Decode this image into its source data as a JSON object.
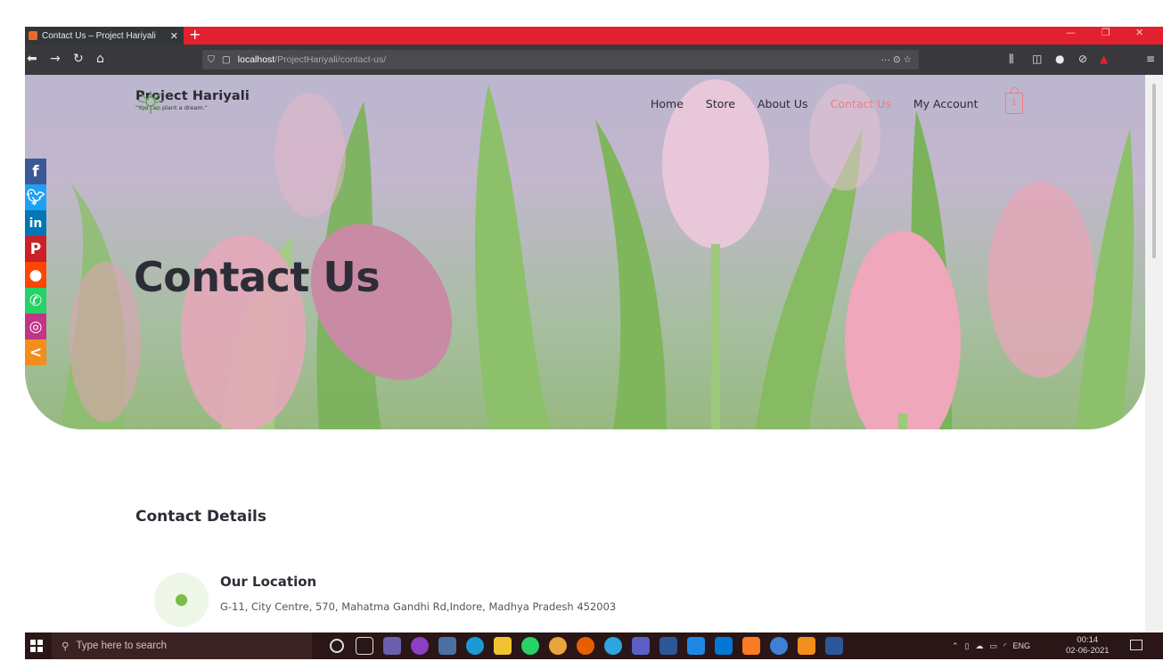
{
  "browser": {
    "tab_title": "Contact Us – Project Hariyali",
    "tab_close": "✕",
    "new_tab": "+",
    "url_host": "localhost",
    "url_path": "/ProjectHariyali/contact-us/",
    "url_actions": "··· ⊙ ☆"
  },
  "site": {
    "brand_name": "Project Hariyali",
    "tagline": "\"You can plant a dream.\"",
    "nav": [
      {
        "label": "Home"
      },
      {
        "label": "Store"
      },
      {
        "label": "About Us"
      },
      {
        "label": "Contact Us"
      },
      {
        "label": "My Account"
      }
    ],
    "active_nav": "Contact Us",
    "cart_count": "1",
    "accent_color": "#f07c7c",
    "hero_title": "Contact Us"
  },
  "social": [
    {
      "icon": "facebook-icon",
      "glyph": "f",
      "color": "#3b5998"
    },
    {
      "icon": "twitter-icon",
      "glyph": "🐦︎",
      "color": "#1da1f2"
    },
    {
      "icon": "linkedin-icon",
      "glyph": "in",
      "color": "#0077b5"
    },
    {
      "icon": "pinterest-icon",
      "glyph": "P",
      "color": "#cb2027"
    },
    {
      "icon": "reddit-icon",
      "glyph": "●",
      "color": "#ff4500"
    },
    {
      "icon": "whatsapp-icon",
      "glyph": "✆",
      "color": "#25d366"
    },
    {
      "icon": "instagram-icon",
      "glyph": "◎",
      "color": "#c13584"
    },
    {
      "icon": "share-icon",
      "glyph": "<",
      "color": "#f28e1c"
    }
  ],
  "contact": {
    "section_title": "Contact Details",
    "location_title": "Our Location",
    "location_address": "G-11, City Centre, 570, Mahatma Gandhi Rd,Indore, Madhya Pradesh 452003"
  },
  "taskbar": {
    "search_placeholder": "Type here to search",
    "tray_lang": "ENG",
    "time": "00:14",
    "date": "02-06-2021",
    "app_icons": [
      {
        "icon": "cortana-icon",
        "color": "#2a1616"
      },
      {
        "icon": "task-view-icon",
        "color": "#2a1616"
      },
      {
        "icon": "app-icon-1",
        "color": "#6b5fb0"
      },
      {
        "icon": "app-icon-2",
        "color": "#8b3fc2"
      },
      {
        "icon": "app-icon-3",
        "color": "#4a6fa0"
      },
      {
        "icon": "edge-icon",
        "color": "#1b9ad6"
      },
      {
        "icon": "explorer-icon",
        "color": "#f1c232"
      },
      {
        "icon": "whatsapp-icon",
        "color": "#25d366"
      },
      {
        "icon": "chrome-icon",
        "color": "#e8a33d"
      },
      {
        "icon": "firefox-icon",
        "color": "#e66000"
      },
      {
        "icon": "telegram-icon",
        "color": "#2ca5e0"
      },
      {
        "icon": "teams-icon",
        "color": "#5b5fc7"
      },
      {
        "icon": "dev-icon",
        "color": "#2b5797"
      },
      {
        "icon": "app-icon-4",
        "color": "#1e88e5"
      },
      {
        "icon": "vscode-icon",
        "color": "#0078d4"
      },
      {
        "icon": "xampp-icon",
        "color": "#fb7a24"
      },
      {
        "icon": "app-icon-5",
        "color": "#3f7fd6"
      },
      {
        "icon": "vlc-icon",
        "color": "#f28e1c"
      },
      {
        "icon": "word-icon",
        "color": "#2b579a"
      }
    ]
  }
}
